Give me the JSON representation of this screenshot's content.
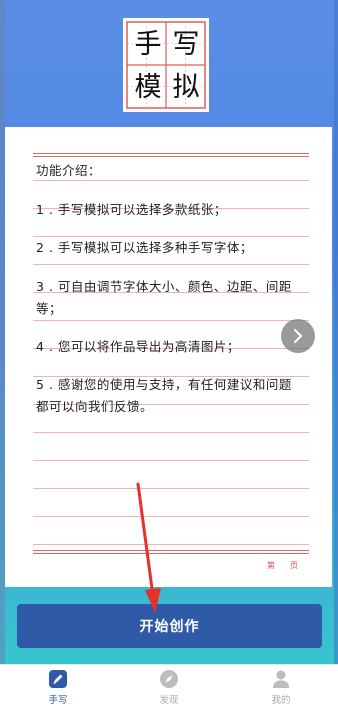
{
  "logo": {
    "chars": [
      "手",
      "写",
      "模",
      "拟"
    ]
  },
  "paper": {
    "lines": [
      "功能介绍：",
      "1 . 手写模拟可以选择多款纸张；",
      "2 . 手写模拟可以选择多种手写字体；",
      "3 . 可自由调节字体大小、颜色、边距、间距",
      "等；",
      "4 . 您可以将作品导出为高清图片；",
      "5 . 感谢您的使用与支持，有任何建议和问题",
      "都可以向我们反馈。"
    ],
    "page_left": "第",
    "page_right": "页"
  },
  "next_icon": "chevron-right-icon",
  "start_button": {
    "label": "开始创作"
  },
  "tabs": [
    {
      "label": "手写",
      "icon": "pen-icon",
      "active": true
    },
    {
      "label": "发现",
      "icon": "compass-icon",
      "active": false
    },
    {
      "label": "我的",
      "icon": "user-icon",
      "active": false
    }
  ],
  "colors": {
    "accent": "#2f5aa8",
    "arrow": "#e8302a",
    "rule": "#f0b3b3"
  }
}
